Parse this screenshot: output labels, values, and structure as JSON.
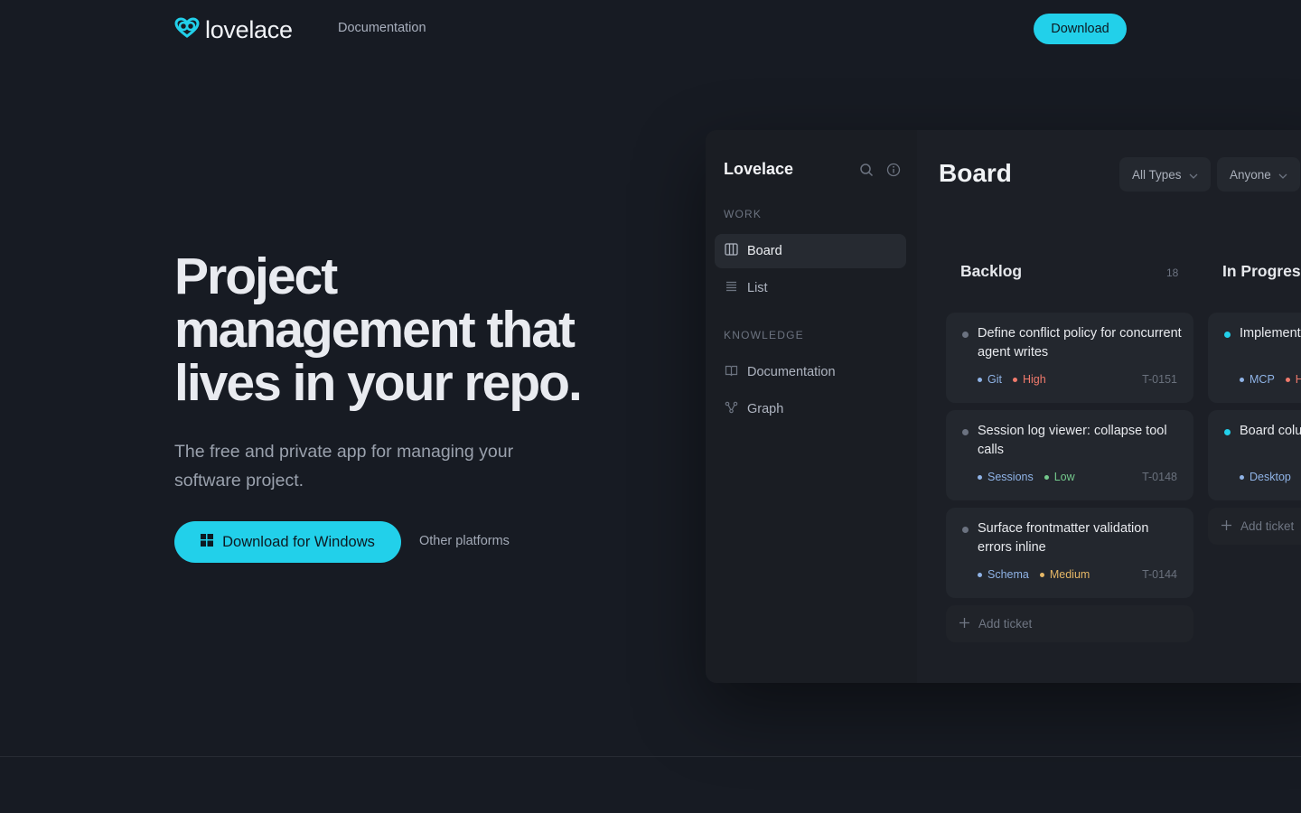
{
  "header": {
    "logo_text": "lovelace",
    "nav_documentation": "Documentation",
    "download_label": "Download"
  },
  "hero": {
    "title": "Project management that lives in your repo.",
    "subtitle": "The free and private app for managing your software project.",
    "cta_primary": "Download for Windows",
    "cta_secondary": "Other platforms"
  },
  "app": {
    "brand": "Lovelace",
    "sidebar": {
      "work_section": "WORK",
      "work_items": [
        {
          "label": "Board",
          "icon": "board-icon",
          "active": true
        },
        {
          "label": "List",
          "icon": "list-icon",
          "active": false
        }
      ],
      "knowledge_section": "KNOWLEDGE",
      "knowledge_items": [
        {
          "label": "Documentation",
          "icon": "book-icon"
        },
        {
          "label": "Graph",
          "icon": "graph-icon"
        }
      ]
    },
    "main": {
      "title": "Board",
      "filters": [
        "All Types",
        "Anyone"
      ],
      "columns": [
        {
          "title": "Backlog",
          "count": "18",
          "cards": [
            {
              "title": "Define conflict policy for concurrent agent writes",
              "tag": "Git",
              "priority": "High",
              "id": "T-0151"
            },
            {
              "title": "Session log viewer: collapse tool calls",
              "tag": "Sessions",
              "priority": "Low",
              "id": "T-0148"
            },
            {
              "title": "Surface frontmatter validation errors inline",
              "tag": "Schema",
              "priority": "Medium",
              "id": "T-0144"
            }
          ],
          "add_label": "Add ticket"
        },
        {
          "title": "In Progress",
          "cards": [
            {
              "title": "Implement frontmatter",
              "tag": "MCP",
              "priority": "H"
            },
            {
              "title": "Board column large project",
              "tag": "Desktop"
            }
          ],
          "add_label": "Add ticket"
        }
      ]
    }
  },
  "colors": {
    "accent": "#22d0ea",
    "background": "#171b23",
    "priority_high": "#f07a6c",
    "priority_low": "#74c98c",
    "priority_medium": "#e5b766",
    "tag": "#8fb3e6",
    "status_backlog_dot": "#6b7280",
    "status_progress_dot": "#22d0ea"
  }
}
